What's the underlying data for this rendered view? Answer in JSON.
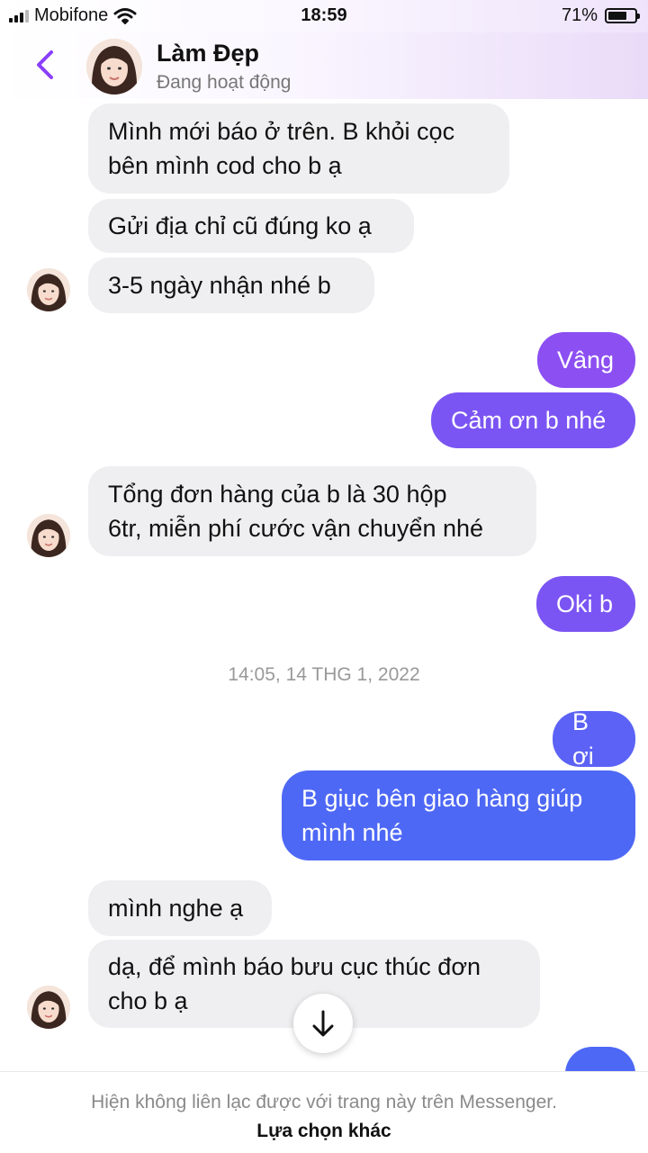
{
  "status_bar": {
    "carrier": "Mobifone",
    "time": "18:59",
    "battery_percent": "71%",
    "battery_level": 0.71
  },
  "header": {
    "name": "Làm Đẹp",
    "status": "Đang hoạt động"
  },
  "messages": [
    {
      "id": 1,
      "direction": "in",
      "lines": [
        "Mình mới báo ở trên. B khỏi cọc",
        "bên mình cod cho b ạ"
      ]
    },
    {
      "id": 2,
      "direction": "in",
      "lines": [
        "Gửi địa chỉ cũ đúng ko ạ"
      ]
    },
    {
      "id": 3,
      "direction": "in",
      "lines": [
        "3-5 ngày nhận nhé b"
      ]
    },
    {
      "id": 4,
      "direction": "out",
      "lines": [
        "Vâng"
      ]
    },
    {
      "id": 5,
      "direction": "out",
      "lines": [
        "Cảm ơn b nhé"
      ]
    },
    {
      "id": 6,
      "direction": "in",
      "lines": [
        "Tổng đơn hàng  của b là 30 hộp",
        "6tr, miễn phí cước vận chuyển nhé"
      ]
    },
    {
      "id": 7,
      "direction": "out",
      "lines": [
        "Oki b"
      ]
    },
    {
      "id": 8,
      "direction": "out",
      "lines": [
        "B ơi"
      ]
    },
    {
      "id": 9,
      "direction": "out",
      "lines": [
        "B giục bên giao hàng giúp",
        "mình nhé"
      ]
    },
    {
      "id": 10,
      "direction": "in",
      "lines": [
        "mình nghe ạ"
      ]
    },
    {
      "id": 11,
      "direction": "in",
      "lines": [
        "dạ, để mình báo bưu cục thúc đơn",
        "cho b ạ"
      ]
    }
  ],
  "timestamp": "14:05, 14 THG 1, 2022",
  "footer": {
    "notice": "Hiện không liên lạc được với trang này trên Messenger.",
    "action": "Lựa chọn khác"
  },
  "icons": {
    "back": "chevron-left-icon",
    "scroll": "arrow-down-icon",
    "signal": "signal-icon",
    "wifi": "wifi-icon",
    "battery": "battery-icon"
  },
  "colors": {
    "accent": "#8a3ffc",
    "incoming_bubble": "#efeff1",
    "outgoing_top": "#8c4ff2",
    "outgoing_bottom": "#4e68f6"
  }
}
